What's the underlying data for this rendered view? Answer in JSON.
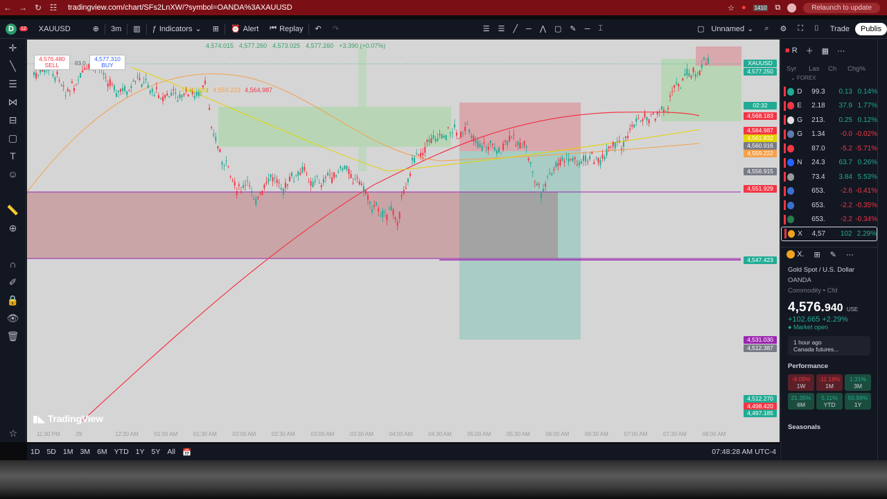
{
  "browser": {
    "url": "tradingview.com/chart/SFs2LnXW/?symbol=OANDA%3AXAUUSD",
    "relaunch": "Relaunch to update",
    "badge": "1410"
  },
  "toolbar": {
    "symbol": "XAUUSD",
    "interval": "3m",
    "indicators": "Indicators",
    "alert": "Alert",
    "replay": "Replay",
    "layout_name": "Unnamed",
    "trade": "Trade",
    "publish": "Publis",
    "avatar_badge": "12"
  },
  "chart_header": {
    "o": "4,574.015",
    "h": "4,577.260",
    "l": "4,573.025",
    "c": "4,577.260",
    "chg": "+3.390 (+0.07%)",
    "sell_price": "4,576.480",
    "sell": "SELL",
    "spread": "83.0",
    "buy_price": "4,577.310",
    "buy": "BUY",
    "ma1": "4,561.832",
    "ma2": "4,559.223",
    "ma3": "4,564.987"
  },
  "price_labels": [
    {
      "text": "XAUUSD",
      "color": "#22ab94"
    },
    {
      "text": "4,577.250",
      "color": "#22ab94"
    },
    {
      "text": "02:32",
      "color": "#22ab94"
    },
    {
      "text": "4,568.183",
      "color": "#f23645"
    },
    {
      "text": "4,564.987",
      "color": "#f23645"
    },
    {
      "text": "4,561.832",
      "color": "#e5d300"
    },
    {
      "text": "4,560.916",
      "color": "#787b86"
    },
    {
      "text": "4,559.222",
      "color": "#f5a04a"
    },
    {
      "text": "4,556.915",
      "color": "#787b86"
    },
    {
      "text": "4,551.929",
      "color": "#f23645"
    },
    {
      "text": "4,547.423",
      "color": "#22ab94"
    },
    {
      "text": "4,531.030",
      "color": "#9c27b0"
    },
    {
      "text": "4,512.387",
      "color": "#787b86"
    },
    {
      "text": "4,512.270",
      "color": "#22ab94"
    },
    {
      "text": "4,498.420",
      "color": "#f23645"
    },
    {
      "text": "4,497.185",
      "color": "#22ab94"
    }
  ],
  "time_labels": [
    "11:30 PM",
    "29",
    "12:30 AM",
    "01:00 AM",
    "01:30 AM",
    "02:00 AM",
    "02:30 AM",
    "03:00 AM",
    "03:30 AM",
    "04:00 AM",
    "04:30 AM",
    "05:00 AM",
    "05:30 AM",
    "06:00 AM",
    "06:30 AM",
    "07:00 AM",
    "07:30 AM",
    "08:00 AM"
  ],
  "watermark": "TradingView",
  "bottom": {
    "ranges": [
      "1D",
      "5D",
      "1M",
      "3M",
      "6M",
      "YTD",
      "1Y",
      "5Y",
      "All"
    ],
    "clock": "07:48:28 AM UTC-4"
  },
  "watchlist": {
    "title": "R",
    "columns": [
      "Syr",
      "Las",
      "Ch",
      "Chg%"
    ],
    "section": "FOREX",
    "rows": [
      {
        "sym": "D",
        "last": "99.3",
        "chg": "0.13",
        "pct": "0.14%",
        "dir": "up",
        "color": "#22ab94"
      },
      {
        "sym": "E",
        "last": "2.18",
        "chg": "37.9",
        "pct": "1.77%",
        "dir": "up",
        "color": "#f23645"
      },
      {
        "sym": "G",
        "last": "213.",
        "chg": "0.25",
        "pct": "0.12%",
        "dir": "up",
        "color": "#e0e0e0"
      },
      {
        "sym": "G",
        "last": "1.34",
        "chg": "-0.0",
        "pct": "-0.02%",
        "dir": "down",
        "color": "#5f7ba8"
      },
      {
        "sym": "",
        "last": "87.0",
        "chg": "-5.2",
        "pct": "-5.71%",
        "dir": "down",
        "color": "#f23645"
      },
      {
        "sym": "N",
        "last": "24.3",
        "chg": "63.7",
        "pct": "0.26%",
        "dir": "up",
        "color": "#2962ff"
      },
      {
        "sym": "",
        "last": "73.4",
        "chg": "3.84",
        "pct": "5.53%",
        "dir": "up",
        "color": "#9a9a9a"
      },
      {
        "sym": "",
        "last": "653.",
        "chg": "-2.6",
        "pct": "-0.41%",
        "dir": "down",
        "color": "#3c6fd0"
      },
      {
        "sym": "",
        "last": "653.",
        "chg": "-2.2",
        "pct": "-0.35%",
        "dir": "down",
        "color": "#3c6fd0"
      },
      {
        "sym": "",
        "last": "653.",
        "chg": "-2.2",
        "pct": "-0.34%",
        "dir": "down",
        "color": "#2a7a4b"
      },
      {
        "sym": "X",
        "last": "4,57",
        "chg": "102",
        "pct": "2.29%",
        "dir": "up",
        "color": "#f2a31b"
      }
    ]
  },
  "details": {
    "symbol": "X.",
    "name": "Gold Spot / U.S. Dollar",
    "exchange": "OANDA",
    "type": "Commodity",
    "type2": "Cfd",
    "price": "4,576.",
    "price_small": "940",
    "currency": "USE",
    "change": "+102.665",
    "change_pct": "+2.29%",
    "status": "Market open",
    "news_time": "1 hour ago",
    "news_text": "Canada futures...",
    "performance": "Performance",
    "perf": [
      {
        "v": "-9.09%",
        "l": "1W",
        "dir": "down"
      },
      {
        "v": "-11.18%",
        "l": "1M",
        "dir": "down"
      },
      {
        "v": "1.31%",
        "l": "3M",
        "dir": "up"
      },
      {
        "v": "21.35%",
        "l": "6M",
        "dir": "up"
      },
      {
        "v": "5.11%",
        "l": "YTD",
        "dir": "up"
      },
      {
        "v": "50.99%",
        "l": "1Y",
        "dir": "up"
      }
    ],
    "seasonals": "Seasonals"
  }
}
